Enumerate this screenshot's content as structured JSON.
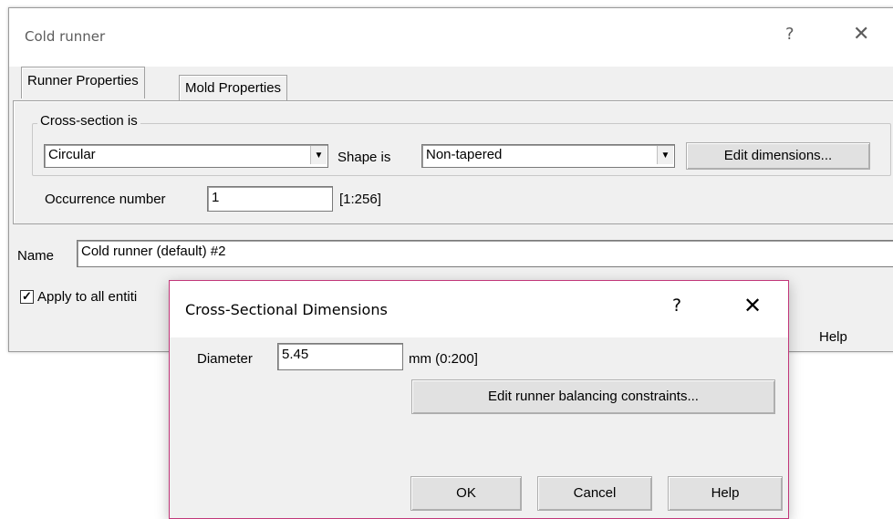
{
  "window": {
    "title": "Cold runner",
    "help_glyph": "?",
    "close_glyph": "✕"
  },
  "tabs": [
    {
      "label": "Runner Properties",
      "active": true
    },
    {
      "label": "Mold Properties",
      "active": false
    }
  ],
  "cross_section": {
    "group_label": "Cross-section is",
    "value": "Circular",
    "shape_label": "Shape is",
    "shape_value": "Non-tapered",
    "edit_button": "Edit dimensions..."
  },
  "occurrence": {
    "label": "Occurrence number",
    "value": "1",
    "range": "[1:256]"
  },
  "name_field": {
    "label": "Name",
    "value": "Cold runner (default) #2"
  },
  "apply_all": {
    "label": "Apply to all entiti",
    "checked": true
  },
  "main_help_button": "Help",
  "dialog": {
    "title": "Cross-Sectional Dimensions",
    "help_glyph": "?",
    "close_glyph": "✕",
    "diameter_label": "Diameter",
    "diameter_value": "5.45",
    "diameter_unit": "mm (0:200]",
    "balancing_button": "Edit runner balancing constraints...",
    "ok_button": "OK",
    "cancel_button": "Cancel",
    "help_button": "Help"
  },
  "colors": {
    "dialog_border": "#c2377a",
    "window_bg": "#f0f0f0"
  }
}
